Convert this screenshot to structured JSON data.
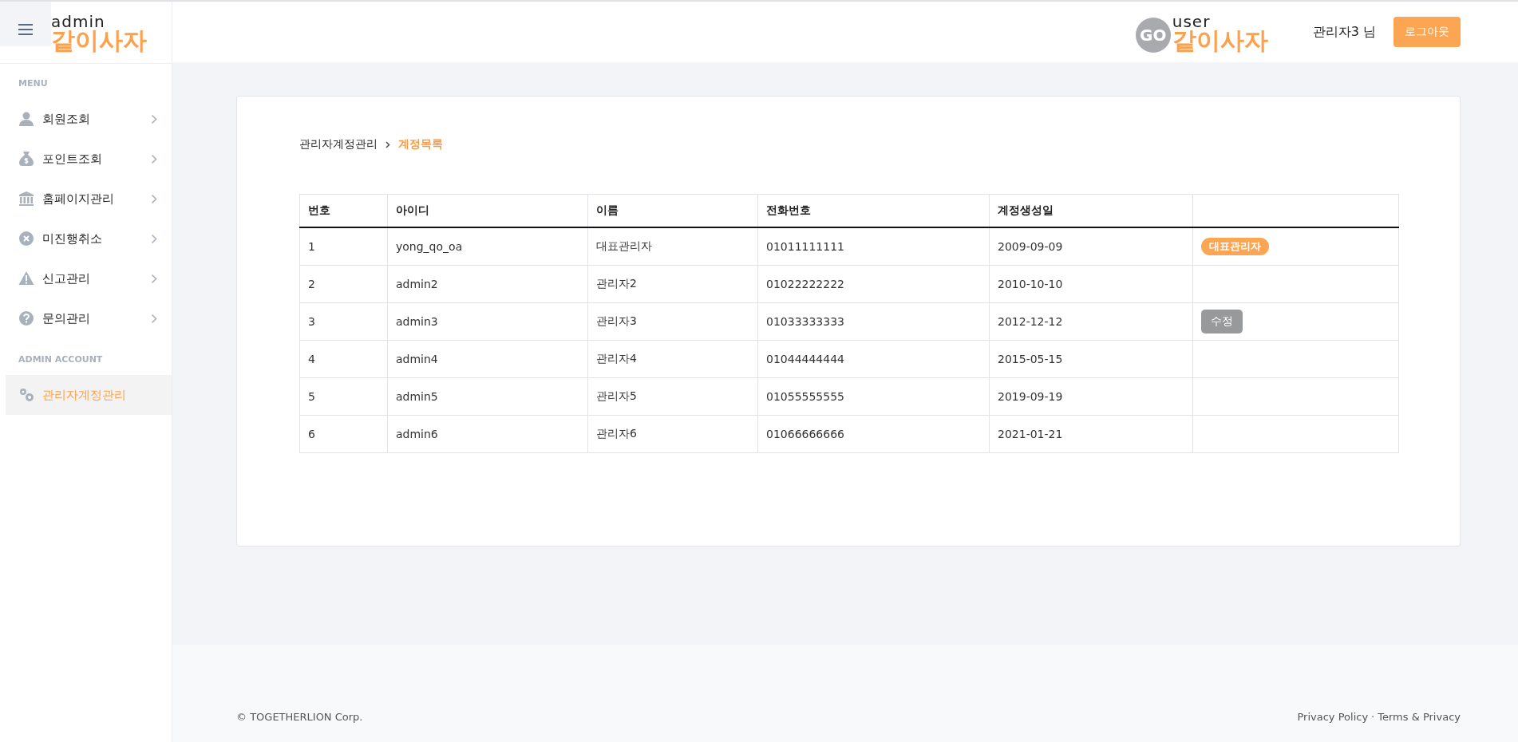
{
  "header": {
    "admin_logo": {
      "caption": "admin",
      "name": "같이사자"
    },
    "user_logo": {
      "badge": "GO",
      "caption": "user",
      "name": "같이사자"
    },
    "user_name": "관리자3 님",
    "logout_button": "로그아웃"
  },
  "sidebar": {
    "sections": [
      {
        "title": "MENU",
        "items": [
          {
            "label": "회원조회",
            "selected": false
          },
          {
            "label": "포인트조회",
            "selected": false
          },
          {
            "label": "홈페이지관리",
            "selected": false
          },
          {
            "label": "미진행취소",
            "selected": false
          },
          {
            "label": "신고관리",
            "selected": false
          },
          {
            "label": "문의관리",
            "selected": false
          }
        ]
      },
      {
        "title": "ADMIN ACCOUNT",
        "items": [
          {
            "label": "관리자계정관리",
            "selected": true
          }
        ]
      }
    ]
  },
  "breadcrumb": {
    "parent": "관리자계정관리",
    "current": "계정목록"
  },
  "table": {
    "columns": [
      "번호",
      "아이디",
      "이름",
      "전화번호",
      "계정생성일",
      ""
    ],
    "rows": [
      {
        "cells": [
          "1",
          "yong_qo_oa",
          "대표관리자",
          "01011111111",
          "2009-09-09"
        ],
        "action": {
          "kind": "badge",
          "label": "대표관리자"
        }
      },
      {
        "cells": [
          "2",
          "admin2",
          "관리자2",
          "01022222222",
          "2010-10-10"
        ]
      },
      {
        "cells": [
          "3",
          "admin3",
          "관리자3",
          "01033333333",
          "2012-12-12"
        ],
        "action": {
          "kind": "button",
          "label": "수정"
        }
      },
      {
        "cells": [
          "4",
          "admin4",
          "관리자4",
          "01044444444",
          "2015-05-15"
        ]
      },
      {
        "cells": [
          "5",
          "admin5",
          "관리자5",
          "01055555555",
          "2019-09-19"
        ]
      },
      {
        "cells": [
          "6",
          "admin6",
          "관리자6",
          "01066666666",
          "2021-01-21"
        ]
      }
    ]
  },
  "footer": {
    "copyright": "© TOGETHERLION Corp.",
    "links": [
      "Privacy Policy",
      "Terms & Privacy"
    ],
    "separator": "·"
  }
}
